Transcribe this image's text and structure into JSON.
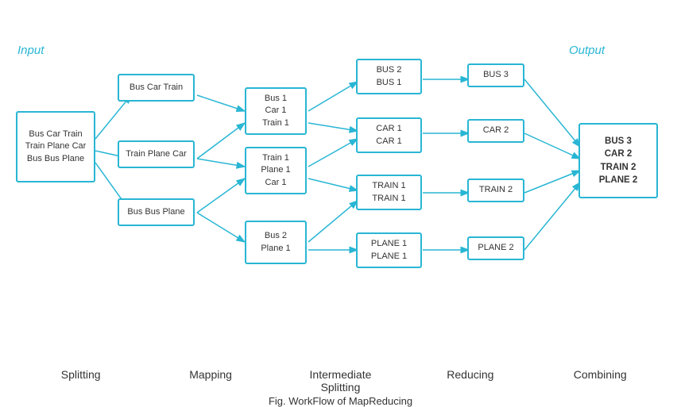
{
  "title": "Fig. WorkFlow of MapReducing",
  "section_input": "Input",
  "section_output": "Output",
  "stages": [
    "Splitting",
    "Mapping",
    "Intermediate\nSplitting",
    "Reducing",
    "Combining"
  ],
  "boxes": {
    "input": "Bus Car Train\nTrain Plane Car\nBus Bus Plane",
    "split1": "Bus Car Train",
    "split2": "Train Plane Car",
    "split3": "Bus Bus Plane",
    "map1": "Bus 1\nCar 1\nTrain 1",
    "map2": "Train 1\nPlane 1\nCar 1",
    "map3": "Bus 2\nPlane 1",
    "inter1": "BUS 2\nBUS 1",
    "inter2": "CAR 1\nCAR 1",
    "inter3": "TRAIN 1\nTRAIN 1",
    "inter4": "PLANE 1\nPLANE 1",
    "reduce1": "BUS 3",
    "reduce2": "CAR  2",
    "reduce3": "TRAIN 2",
    "reduce4": "PLANE 2",
    "output": "BUS 3\nCAR 2\nTRAIN 2\nPLANE 2"
  },
  "caption": "Fig. WorkFlow of MapReducing"
}
